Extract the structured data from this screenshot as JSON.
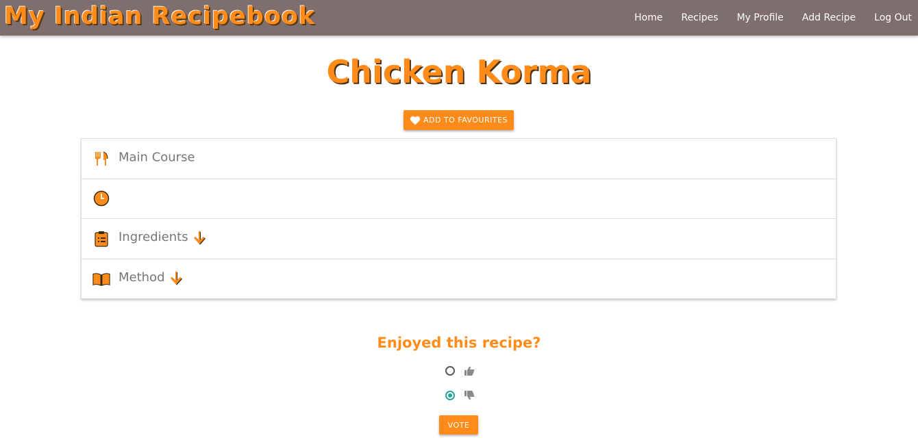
{
  "brand": {
    "name": "My Indian Recipebook"
  },
  "nav": {
    "items": [
      {
        "label": "Home"
      },
      {
        "label": "Recipes"
      },
      {
        "label": "My Profile"
      },
      {
        "label": "Add Recipe"
      },
      {
        "label": "Log Out"
      }
    ]
  },
  "recipe": {
    "title": "Chicken Korma",
    "favourite_label": "ADD TO FAVOURITES",
    "rows": [
      {
        "icon": "cutlery-icon",
        "label": "Main Course"
      },
      {
        "icon": "clock-icon",
        "label": ""
      },
      {
        "icon": "clipboard-icon",
        "label": "Ingredients",
        "arrow": "arrow-down-icon"
      },
      {
        "icon": "book-icon",
        "label": "Method",
        "arrow": "arrow-down-icon"
      }
    ]
  },
  "vote": {
    "heading": "Enjoyed this recipe?",
    "options": [
      {
        "icon": "thumbs-up-icon",
        "selected": false
      },
      {
        "icon": "thumbs-down-icon",
        "selected": true
      }
    ],
    "button_label": "VOTE"
  },
  "colors": {
    "accent": "#ff8c1a",
    "navbar": "#7e6e6e",
    "radio_selected": "#26a69a"
  }
}
